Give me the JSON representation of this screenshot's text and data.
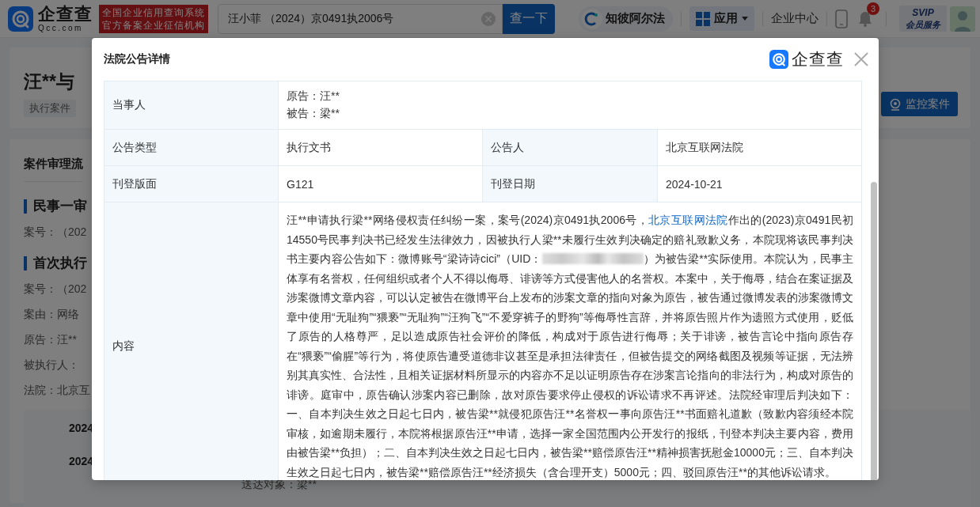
{
  "header": {
    "logo": {
      "name": "企查查",
      "domain": "Qcc.com"
    },
    "slogan": [
      "全国企业信用查询系统",
      "官方备案企业征信机构"
    ],
    "search": {
      "value": "汪小菲 （2024）京0491执2006号"
    },
    "search_button": "查一下",
    "nav": [
      {
        "kind": "pill",
        "label": "知彼阿尔法"
      },
      {
        "kind": "menu",
        "label": "应用"
      },
      {
        "kind": "link",
        "label": "企业中心"
      }
    ],
    "notifications": {
      "badge": "3"
    },
    "vip": {
      "top": "SVIP",
      "bottom": "会员服务"
    }
  },
  "page": {
    "title": "汪**与",
    "tags": [
      "执行案件"
    ],
    "monitor_button": "监控案件",
    "process": {
      "title": "案件审理流",
      "stages": [
        {
          "title": "民事一审",
          "fields": [
            "案号：（202"
          ]
        },
        {
          "title": "首次执行",
          "fields": [
            "案号：（202",
            "案由：网络",
            "原告：汪**",
            "被执行人：",
            "法院：北京互"
          ]
        }
      ],
      "timeline": [
        {
          "date": "2024"
        },
        {
          "date": "2024"
        }
      ],
      "recipient": "送达对象：梁**"
    }
  },
  "modal": {
    "title": "法院公告详情",
    "brand": "企查查",
    "parties": {
      "label": "当事人",
      "values": [
        "原告：汪**",
        "被告：梁**"
      ]
    },
    "fields": [
      [
        {
          "label": "公告类型",
          "value": "执行文书"
        },
        {
          "label": "公告人",
          "value": "北京互联网法院"
        }
      ],
      [
        {
          "label": "刊登版面",
          "value": "G121"
        },
        {
          "label": "刊登日期",
          "value": "2024-10-21"
        }
      ]
    ],
    "content": {
      "label": "内容",
      "segments": [
        {
          "kind": "text",
          "text": "汪**申请执行梁**网络侵权责任纠纷一案，案号(2024)京0491执2006号，"
        },
        {
          "kind": "link",
          "text": "北京互联网法院"
        },
        {
          "kind": "text",
          "text": "作出的(2023)京0491民初14550号民事判决书已经发生法律效力，因被执行人梁**未履行生效判决确定的赔礼致歉义务，本院现将该民事判决书主要内容公告如下：微博账号“梁诗诗cici”（UID："
        },
        {
          "kind": "redacted"
        },
        {
          "kind": "text",
          "text": "）为被告梁**实际使用。本院认为，民事主体享有名誉权，任何组织或者个人不得以侮辱、诽谤等方式侵害他人的名誉权。本案中，关于侮辱，结合在案证据及涉案微博文章内容，可以认定被告在微博平台上发布的涉案文章的指向对象为原告，被告通过微博发表的涉案微博文章中使用“无耻狗”“猥亵”“无耻狗”“汪狗飞”“不爱穿裤子的野狗”等侮辱性言辞，并将原告照片作为遗照方式使用，贬低了原告的人格尊严，足以造成原告社会评价的降低，构成对于原告进行侮辱；关于诽谤，被告言论中指向原告存在“猥亵”“偷腥”等行为，将使原告遭受道德非议甚至是承担法律责任，但被告提交的网络截图及视频等证据，无法辨别其真实性、合法性，且相关证据材料所显示的内容亦不足以证明原告存在涉案言论指向的非法行为，构成对原告的诽谤。庭审中，原告确认涉案内容已删除，故对原告要求停止侵权的诉讼请求不再评述。法院经审理后判决如下：一、自本判决生效之日起七日内，被告梁**就侵犯原告汪**名誉权一事向原告汪**书面赔礼道歉（致歉内容须经本院审核，如逾期未履行，本院将根据原告汪**申请，选择一家全国范围内公开发行的报纸，刊登本判决主要内容，费用由被告梁**负担）；二、自本判决生效之日起七日内，被告梁**赔偿原告汪**精神损害抚慰金10000元；三、自本判决生效之日起七日内，被告梁**赔偿原告汪**经济损失（含合理开支）5000元；四、驳回原告汪**的其他诉讼请求。"
        }
      ]
    }
  }
}
